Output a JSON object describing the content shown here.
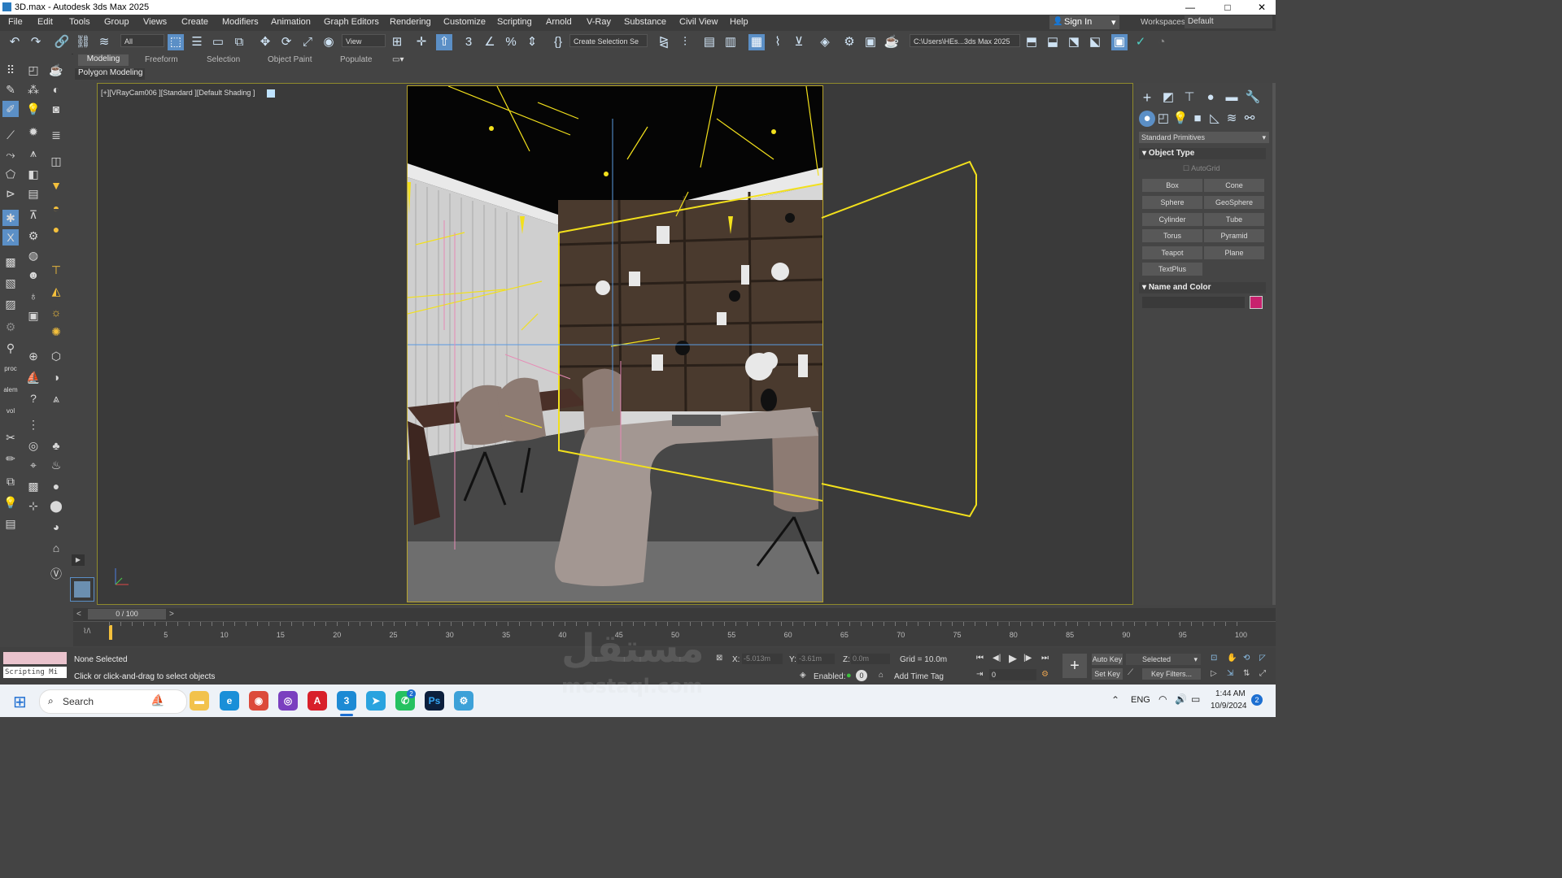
{
  "titlebar": {
    "title": "3D.max - Autodesk 3ds Max 2025",
    "minimize": "—",
    "maximize": "□",
    "close": "✕"
  },
  "menu": [
    "File",
    "Edit",
    "Tools",
    "Group",
    "Views",
    "Create",
    "Modifiers",
    "Animation",
    "Graph Editors",
    "Rendering",
    "Customize",
    "Scripting",
    "Arnold",
    "V-Ray",
    "Substance",
    "Civil View",
    "Help"
  ],
  "signin": {
    "label": "Sign In",
    "arrow": "▾"
  },
  "workspace": {
    "label": "Workspaces:",
    "value": "Default"
  },
  "toolbar": {
    "filter_value": "All",
    "refcoord_value": "View",
    "selection_set_placeholder": "Create Selection Se",
    "project_path": "C:\\Users\\HEs...3ds Max 2025"
  },
  "ribbon": {
    "tabs": [
      "Modeling",
      "Freeform",
      "Selection",
      "Object Paint",
      "Populate"
    ],
    "panel_label": "Polygon Modeling"
  },
  "viewport": {
    "label": "[+][VRayCam006 ][Standard ][Default Shading ]"
  },
  "command_panel": {
    "category": "Standard Primitives",
    "object_type_title": "Object Type",
    "autogrid_label": "AutoGrid",
    "buttons": [
      "Box",
      "Cone",
      "Sphere",
      "GeoSphere",
      "Cylinder",
      "Tube",
      "Torus",
      "Pyramid",
      "Teapot",
      "Plane",
      "TextPlus"
    ],
    "name_color_title": "Name and Color",
    "name_value": "",
    "object_color": "#c8226e"
  },
  "timeslider": {
    "label": "0 / 100",
    "prev": "<",
    "next": ">"
  },
  "timeline": {
    "ticks": [
      "5",
      "10",
      "15",
      "20",
      "25",
      "30",
      "35",
      "40",
      "45",
      "50",
      "55",
      "60",
      "65",
      "70",
      "75",
      "80",
      "85",
      "90",
      "95",
      "100"
    ]
  },
  "status": {
    "maxscript_label": "Scripting Mi",
    "selection_text": "None Selected",
    "prompt_text": "Click or click-and-drag to select objects",
    "x_label": "X:",
    "x_value": "-5.013m",
    "y_label": "Y:",
    "y_value": "-3.61m",
    "z_label": "Z:",
    "z_value": "0.0m",
    "grid": "Grid = 10.0m",
    "enabled_label": "Enabled:",
    "add_time_tag": "Add Time Tag",
    "frame_value": "0",
    "autokey": "Auto Key",
    "setkey": "Set Key",
    "selected_value": "Selected",
    "key_filters": "Key Filters..."
  },
  "taskbar": {
    "search_placeholder": "Search",
    "lang": "ENG",
    "time": "1:44 AM",
    "date": "10/9/2024",
    "notification_count": "2",
    "whatsapp_badge": "2"
  },
  "watermark": {
    "arabic": "مستقل",
    "latin": "mostaql.com"
  }
}
